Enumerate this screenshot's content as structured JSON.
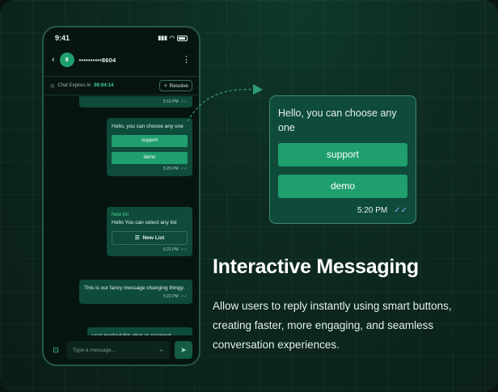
{
  "phone": {
    "status_time": "9:41",
    "contact_avatar": "9",
    "contact_name": "••••••••••8604",
    "expiry_label": "Chat Expires In",
    "expiry_time": "06:04:14",
    "resolve_label": "Resolve",
    "messages": [
      {
        "time": "5:19 PM"
      },
      {
        "text": "Hello, you can choose any one",
        "buttons": [
          "support",
          "demo"
        ],
        "time": "5:20 PM"
      },
      {
        "title": "New list",
        "text": "Hello You can select any list",
        "list_button": "New List",
        "time": "5:21 PM"
      },
      {
        "text": "This is our fancy message changing thingy.",
        "time": "5:22 PM"
      },
      {
        "text": "user marked this chat as resolved"
      }
    ],
    "input_placeholder": "Type a message..."
  },
  "zoom": {
    "text": "Hello, you can choose any one",
    "buttons": [
      "support",
      "demo"
    ],
    "time": "5:20 PM"
  },
  "headline": "Interactive Messaging",
  "description": "Allow users to reply instantly using smart buttons, creating faster, more engaging, and seamless conversation experiences.",
  "icons": [
    "back-icon",
    "kebab-menu-icon",
    "clock-icon",
    "sparkle-icon",
    "double-check-icon",
    "list-icon",
    "template-icon",
    "paperclip-icon",
    "send-icon",
    "dashed-arrow-icon"
  ],
  "colors": {
    "accent": "#1f9e6e",
    "bubble": "#0f4b3a",
    "background": "#0d2a21",
    "highlight": "#3fd695"
  }
}
